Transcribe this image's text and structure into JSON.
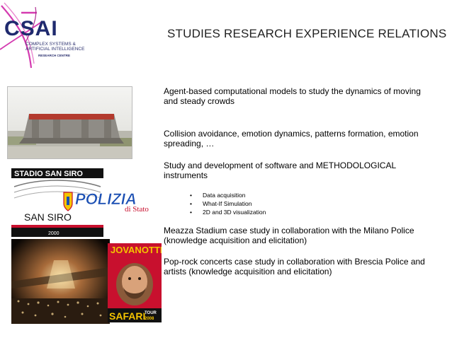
{
  "logo": {
    "big": "CSAI",
    "line1": "COMPLEX SYSTEMS &",
    "line2": "ARTIFICIAL INTELLIGENCE",
    "line3": "RESEARCH CENTRE"
  },
  "title": "STUDIES RESEARCH EXPERIENCE RELATIONS",
  "paragraphs": [
    "Agent-based computational models to study the dynamics of moving and steady crowds",
    "Collision avoidance, emotion dynamics, patterns formation, emotion spreading, …",
    "Study and development of software and METHODOLOGICAL instruments",
    "Meazza Stadium case study in collaboration with the Milano Police (knowledge acquisition and elicitation)",
    "Pop-rock concerts case study in collaboration with Brescia Police and artists (knowledge acquisition and elicitation)"
  ],
  "bullets": [
    "Data acquisition",
    "What-If Simulation",
    "2D and 3D visualization"
  ],
  "bullet_glyph": "•",
  "images": {
    "sansiro_top": "STADIO SAN SIRO",
    "sansiro_mid": "SAN SIRO",
    "sansiro_year": "2000",
    "polizia_main": "POLIZIA",
    "polizia_sub": "di Stato",
    "poster_top": "JOVANOTTI",
    "poster_bottom": "SAFARI",
    "poster_tour": "TOUR",
    "poster_year": "2008"
  },
  "colors": {
    "logo_navy": "#1f2a6e",
    "logo_magenta": "#d43bb0",
    "title": "#222222",
    "polizia_blue": "#1b4fb3",
    "polizia_red": "#c8102e",
    "poster_red": "#c8102e",
    "poster_yellow": "#f4c400"
  }
}
